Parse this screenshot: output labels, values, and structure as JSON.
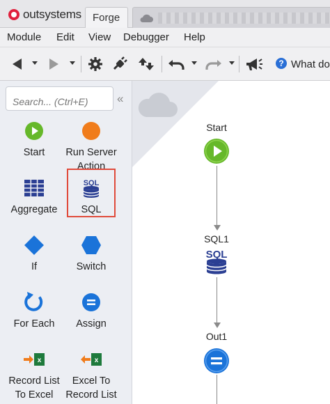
{
  "app": {
    "brand": "outsystems",
    "tabs": [
      {
        "label": "Forge"
      }
    ]
  },
  "menu": [
    "Module",
    "Edit",
    "View",
    "Debugger",
    "Help"
  ],
  "toolbar": {
    "help_text": "What do"
  },
  "toolbox": {
    "search_placeholder": "Search... (Ctrl+E)",
    "tools": [
      {
        "label": "Start"
      },
      {
        "label": "Run Server Action"
      },
      {
        "label": "Aggregate"
      },
      {
        "label": "SQL"
      },
      {
        "label": "If"
      },
      {
        "label": "Switch"
      },
      {
        "label": "For Each"
      },
      {
        "label": "Assign"
      },
      {
        "label": "Record List To Excel"
      },
      {
        "label": "Excel To Record List"
      }
    ]
  },
  "flow": {
    "nodes": [
      {
        "label": "Start"
      },
      {
        "label": "SQL1"
      },
      {
        "label": "Out1"
      }
    ]
  },
  "colors": {
    "green": "#66b82a",
    "orange": "#f07c1b",
    "blue": "#1a73d9",
    "navy": "#2b3f93",
    "highlight": "#e04a3a",
    "excel": "#1e7a3c"
  }
}
